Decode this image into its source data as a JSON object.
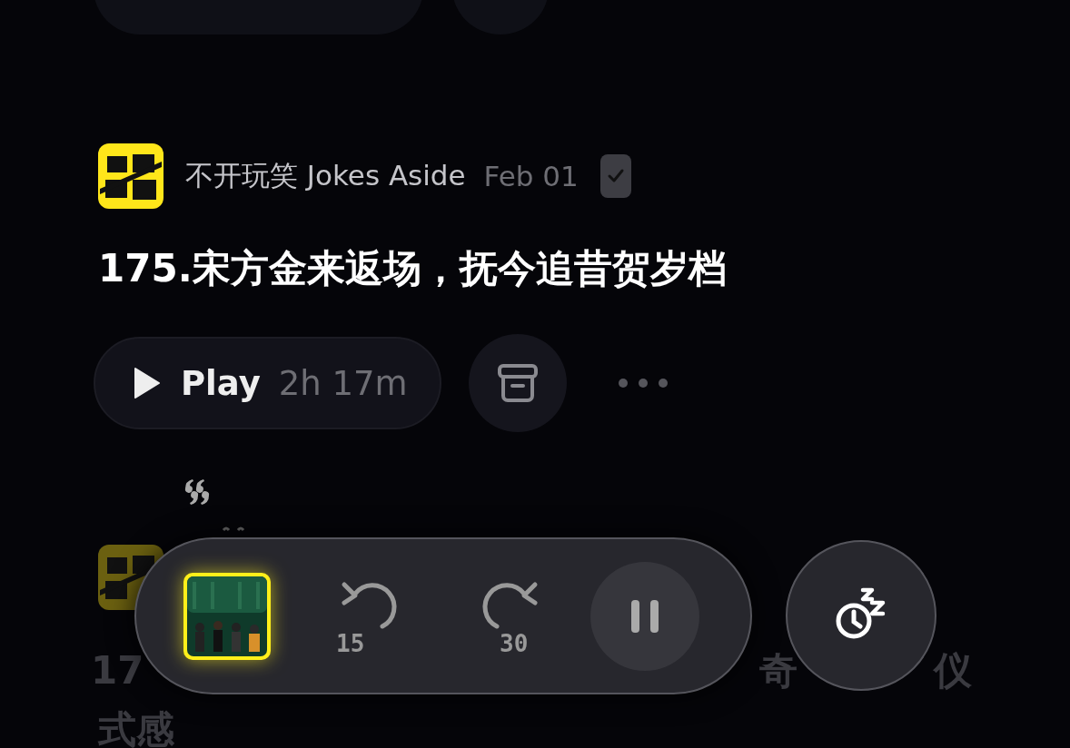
{
  "episode": {
    "podcast": "不开玩笑 Jokes Aside",
    "date": "Feb 01",
    "played": true,
    "title": "175.宋方金来返场，抚今追昔贺岁档",
    "play_label": "Play",
    "duration": "2h 17m"
  },
  "next_episode": {
    "title_line_1_fragments": [
      "17",
      "奇",
      "仪"
    ],
    "title_line_2": "式感"
  },
  "player": {
    "rewind_seconds": "15",
    "forward_seconds": "30",
    "playing": true
  }
}
